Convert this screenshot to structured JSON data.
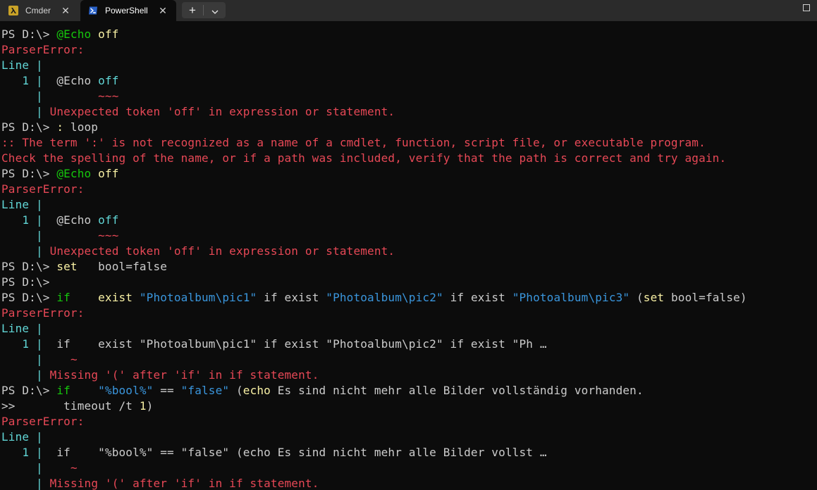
{
  "tabs": [
    {
      "label": "Cmder",
      "icon": "cmder-lambda-icon",
      "active": false
    },
    {
      "label": "PowerShell",
      "icon": "powershell-icon",
      "active": true
    }
  ],
  "tab_close_glyph": "✕",
  "new_tab_glyph": "+",
  "colors": {
    "background": "#0c0c0c",
    "titlebar": "#2b2b2b",
    "default_text": "#cccccc",
    "error_red": "#e74856",
    "string_blue": "#3a96dd",
    "gutter_cyan": "#61d6d6",
    "command_green": "#16c60c",
    "keyword_yellow": "#f9f1a5"
  },
  "terminal_lines": [
    [
      [
        "w",
        "PS D:\\> "
      ],
      [
        "gr",
        "@Echo"
      ],
      [
        "w",
        " "
      ],
      [
        "y",
        "off"
      ]
    ],
    [
      [
        "r",
        "ParserError:"
      ]
    ],
    [
      [
        "cy",
        "Line |"
      ]
    ],
    [
      [
        "cy",
        "   1 | "
      ],
      [
        "w",
        " @Echo "
      ],
      [
        "cy",
        "off"
      ]
    ],
    [
      [
        "cy",
        "     | "
      ],
      [
        "r",
        "       ~~~"
      ]
    ],
    [
      [
        "cy",
        "     | "
      ],
      [
        "r",
        "Unexpected token 'off' in expression or statement."
      ]
    ],
    [
      [
        "w",
        "PS D:\\> "
      ],
      [
        "y",
        ":"
      ],
      [
        "w",
        " loop"
      ]
    ],
    [
      [
        "r",
        ":: The term ':' is not recognized as a name of a cmdlet, function, script file, or executable program."
      ]
    ],
    [
      [
        "r",
        "Check the spelling of the name, or if a path was included, verify that the path is correct and try again."
      ]
    ],
    [
      [
        "w",
        "PS D:\\> "
      ],
      [
        "gr",
        "@Echo"
      ],
      [
        "w",
        " "
      ],
      [
        "y",
        "off"
      ]
    ],
    [
      [
        "r",
        "ParserError:"
      ]
    ],
    [
      [
        "cy",
        "Line |"
      ]
    ],
    [
      [
        "cy",
        "   1 | "
      ],
      [
        "w",
        " @Echo "
      ],
      [
        "cy",
        "off"
      ]
    ],
    [
      [
        "cy",
        "     | "
      ],
      [
        "r",
        "       ~~~"
      ]
    ],
    [
      [
        "cy",
        "     | "
      ],
      [
        "r",
        "Unexpected token 'off' in expression or statement."
      ]
    ],
    [
      [
        "w",
        "PS D:\\> "
      ],
      [
        "y",
        "set"
      ],
      [
        "w",
        "   bool=false"
      ]
    ],
    [
      [
        "w",
        "PS D:\\>"
      ]
    ],
    [
      [
        "w",
        "PS D:\\> "
      ],
      [
        "gr",
        "if"
      ],
      [
        "w",
        "    "
      ],
      [
        "y",
        "exist"
      ],
      [
        "w",
        " "
      ],
      [
        "c",
        "\"Photoalbum\\pic1\""
      ],
      [
        "w",
        " if exist "
      ],
      [
        "c",
        "\"Photoalbum\\pic2\""
      ],
      [
        "w",
        " if exist "
      ],
      [
        "c",
        "\"Photoalbum\\pic3\""
      ],
      [
        "w",
        " ("
      ],
      [
        "y",
        "set"
      ],
      [
        "w",
        " bool=false)"
      ]
    ],
    [
      [
        "r",
        "ParserError:"
      ]
    ],
    [
      [
        "cy",
        "Line |"
      ]
    ],
    [
      [
        "cy",
        "   1 | "
      ],
      [
        "w",
        " if    exist \"Photoalbum\\pic1\" if exist \"Photoalbum\\pic2\" if exist \"Ph …"
      ]
    ],
    [
      [
        "cy",
        "     | "
      ],
      [
        "r",
        "   ~"
      ]
    ],
    [
      [
        "cy",
        "     | "
      ],
      [
        "r",
        "Missing '(' after 'if' in if statement."
      ]
    ],
    [
      [
        "w",
        "PS D:\\> "
      ],
      [
        "gr",
        "if"
      ],
      [
        "w",
        "    "
      ],
      [
        "c",
        "\"%bool%\""
      ],
      [
        "w",
        " == "
      ],
      [
        "c",
        "\"false\""
      ],
      [
        "w",
        " ("
      ],
      [
        "y",
        "echo"
      ],
      [
        "w",
        " Es sind nicht mehr alle Bilder vollständig vorhanden."
      ]
    ],
    [
      [
        "w",
        ">>       timeout /t "
      ],
      [
        "y",
        "1"
      ],
      [
        "w",
        ")"
      ]
    ],
    [
      [
        "r",
        "ParserError:"
      ]
    ],
    [
      [
        "cy",
        "Line |"
      ]
    ],
    [
      [
        "cy",
        "   1 | "
      ],
      [
        "w",
        " if    \"%bool%\" == \"false\" (echo Es sind nicht mehr alle Bilder vollst …"
      ]
    ],
    [
      [
        "cy",
        "     | "
      ],
      [
        "r",
        "   ~"
      ]
    ],
    [
      [
        "cy",
        "     | "
      ],
      [
        "r",
        "Missing '(' after 'if' in if statement."
      ]
    ]
  ]
}
